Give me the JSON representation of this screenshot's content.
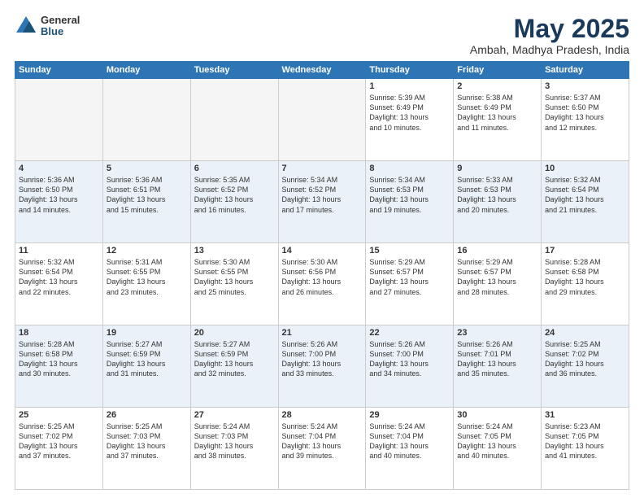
{
  "logo": {
    "general": "General",
    "blue": "Blue"
  },
  "title": "May 2025",
  "subtitle": "Ambah, Madhya Pradesh, India",
  "headers": [
    "Sunday",
    "Monday",
    "Tuesday",
    "Wednesday",
    "Thursday",
    "Friday",
    "Saturday"
  ],
  "weeks": [
    [
      {
        "day": "",
        "info": ""
      },
      {
        "day": "",
        "info": ""
      },
      {
        "day": "",
        "info": ""
      },
      {
        "day": "",
        "info": ""
      },
      {
        "day": "1",
        "info": "Sunrise: 5:39 AM\nSunset: 6:49 PM\nDaylight: 13 hours\nand 10 minutes."
      },
      {
        "day": "2",
        "info": "Sunrise: 5:38 AM\nSunset: 6:49 PM\nDaylight: 13 hours\nand 11 minutes."
      },
      {
        "day": "3",
        "info": "Sunrise: 5:37 AM\nSunset: 6:50 PM\nDaylight: 13 hours\nand 12 minutes."
      }
    ],
    [
      {
        "day": "4",
        "info": "Sunrise: 5:36 AM\nSunset: 6:50 PM\nDaylight: 13 hours\nand 14 minutes."
      },
      {
        "day": "5",
        "info": "Sunrise: 5:36 AM\nSunset: 6:51 PM\nDaylight: 13 hours\nand 15 minutes."
      },
      {
        "day": "6",
        "info": "Sunrise: 5:35 AM\nSunset: 6:52 PM\nDaylight: 13 hours\nand 16 minutes."
      },
      {
        "day": "7",
        "info": "Sunrise: 5:34 AM\nSunset: 6:52 PM\nDaylight: 13 hours\nand 17 minutes."
      },
      {
        "day": "8",
        "info": "Sunrise: 5:34 AM\nSunset: 6:53 PM\nDaylight: 13 hours\nand 19 minutes."
      },
      {
        "day": "9",
        "info": "Sunrise: 5:33 AM\nSunset: 6:53 PM\nDaylight: 13 hours\nand 20 minutes."
      },
      {
        "day": "10",
        "info": "Sunrise: 5:32 AM\nSunset: 6:54 PM\nDaylight: 13 hours\nand 21 minutes."
      }
    ],
    [
      {
        "day": "11",
        "info": "Sunrise: 5:32 AM\nSunset: 6:54 PM\nDaylight: 13 hours\nand 22 minutes."
      },
      {
        "day": "12",
        "info": "Sunrise: 5:31 AM\nSunset: 6:55 PM\nDaylight: 13 hours\nand 23 minutes."
      },
      {
        "day": "13",
        "info": "Sunrise: 5:30 AM\nSunset: 6:55 PM\nDaylight: 13 hours\nand 25 minutes."
      },
      {
        "day": "14",
        "info": "Sunrise: 5:30 AM\nSunset: 6:56 PM\nDaylight: 13 hours\nand 26 minutes."
      },
      {
        "day": "15",
        "info": "Sunrise: 5:29 AM\nSunset: 6:57 PM\nDaylight: 13 hours\nand 27 minutes."
      },
      {
        "day": "16",
        "info": "Sunrise: 5:29 AM\nSunset: 6:57 PM\nDaylight: 13 hours\nand 28 minutes."
      },
      {
        "day": "17",
        "info": "Sunrise: 5:28 AM\nSunset: 6:58 PM\nDaylight: 13 hours\nand 29 minutes."
      }
    ],
    [
      {
        "day": "18",
        "info": "Sunrise: 5:28 AM\nSunset: 6:58 PM\nDaylight: 13 hours\nand 30 minutes."
      },
      {
        "day": "19",
        "info": "Sunrise: 5:27 AM\nSunset: 6:59 PM\nDaylight: 13 hours\nand 31 minutes."
      },
      {
        "day": "20",
        "info": "Sunrise: 5:27 AM\nSunset: 6:59 PM\nDaylight: 13 hours\nand 32 minutes."
      },
      {
        "day": "21",
        "info": "Sunrise: 5:26 AM\nSunset: 7:00 PM\nDaylight: 13 hours\nand 33 minutes."
      },
      {
        "day": "22",
        "info": "Sunrise: 5:26 AM\nSunset: 7:00 PM\nDaylight: 13 hours\nand 34 minutes."
      },
      {
        "day": "23",
        "info": "Sunrise: 5:26 AM\nSunset: 7:01 PM\nDaylight: 13 hours\nand 35 minutes."
      },
      {
        "day": "24",
        "info": "Sunrise: 5:25 AM\nSunset: 7:02 PM\nDaylight: 13 hours\nand 36 minutes."
      }
    ],
    [
      {
        "day": "25",
        "info": "Sunrise: 5:25 AM\nSunset: 7:02 PM\nDaylight: 13 hours\nand 37 minutes."
      },
      {
        "day": "26",
        "info": "Sunrise: 5:25 AM\nSunset: 7:03 PM\nDaylight: 13 hours\nand 37 minutes."
      },
      {
        "day": "27",
        "info": "Sunrise: 5:24 AM\nSunset: 7:03 PM\nDaylight: 13 hours\nand 38 minutes."
      },
      {
        "day": "28",
        "info": "Sunrise: 5:24 AM\nSunset: 7:04 PM\nDaylight: 13 hours\nand 39 minutes."
      },
      {
        "day": "29",
        "info": "Sunrise: 5:24 AM\nSunset: 7:04 PM\nDaylight: 13 hours\nand 40 minutes."
      },
      {
        "day": "30",
        "info": "Sunrise: 5:24 AM\nSunset: 7:05 PM\nDaylight: 13 hours\nand 40 minutes."
      },
      {
        "day": "31",
        "info": "Sunrise: 5:23 AM\nSunset: 7:05 PM\nDaylight: 13 hours\nand 41 minutes."
      }
    ]
  ]
}
